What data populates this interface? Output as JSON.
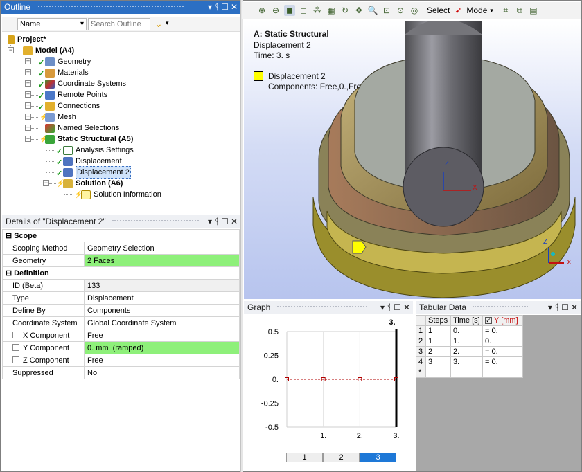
{
  "outline": {
    "title": "Outline",
    "filter_name": "Name",
    "search_placeholder": "Search Outline",
    "nodes": [
      {
        "label": "Project*"
      },
      {
        "label": "Model (A4)"
      },
      {
        "label": "Geometry"
      },
      {
        "label": "Materials"
      },
      {
        "label": "Coordinate Systems"
      },
      {
        "label": "Remote Points"
      },
      {
        "label": "Connections"
      },
      {
        "label": "Mesh"
      },
      {
        "label": "Named Selections"
      },
      {
        "label": "Static Structural (A5)"
      },
      {
        "label": "Analysis Settings"
      },
      {
        "label": "Displacement"
      },
      {
        "label": "Displacement 2"
      },
      {
        "label": "Solution (A6)"
      },
      {
        "label": "Solution Information"
      }
    ]
  },
  "details": {
    "title": "Details of \"Displacement 2\"",
    "groups": {
      "scope": "Scope",
      "definition": "Definition"
    },
    "rows": [
      {
        "label": "Scoping Method",
        "value": "Geometry Selection"
      },
      {
        "label": "Geometry",
        "value": "2 Faces"
      },
      {
        "label": "ID (Beta)",
        "value": "133"
      },
      {
        "label": "Type",
        "value": "Displacement"
      },
      {
        "label": "Define By",
        "value": "Components"
      },
      {
        "label": "Coordinate System",
        "value": "Global Coordinate System"
      },
      {
        "label": "X Component",
        "value": "Free"
      },
      {
        "label": "Y Component",
        "value": "0. mm  (ramped)"
      },
      {
        "label": "Z Component",
        "value": "Free"
      },
      {
        "label": "Suppressed",
        "value": "No"
      }
    ]
  },
  "toolbar": {
    "select_label": "Select",
    "mode_label": "Mode"
  },
  "viewport": {
    "title": "A: Static Structural",
    "subtitle": "Displacement 2",
    "time": "Time: 3. s",
    "legend_label": "Displacement 2",
    "legend_components": "Components: Free,0.,Free mm",
    "axis_z": "Z",
    "axis_x": "X",
    "legend_color": "#ffff00"
  },
  "graph": {
    "title": "Graph",
    "tabs": [
      "1",
      "2",
      "3"
    ],
    "selected_tab": "3"
  },
  "tabular": {
    "title": "Tabular Data",
    "headers": [
      "Steps",
      "Time [s]",
      "Y [mm]"
    ],
    "rows": [
      {
        "n": "1",
        "steps": "1",
        "time": "0.",
        "y": "= 0."
      },
      {
        "n": "2",
        "steps": "1",
        "time": "1.",
        "y": "0."
      },
      {
        "n": "3",
        "steps": "2",
        "time": "2.",
        "y": "= 0."
      },
      {
        "n": "4",
        "steps": "3",
        "time": "3.",
        "y": "= 0."
      },
      {
        "n": "*",
        "steps": "",
        "time": "",
        "y": ""
      }
    ]
  },
  "chart_data": {
    "type": "line",
    "x": [
      0,
      1,
      2,
      3
    ],
    "series": [
      {
        "values": [
          0,
          0,
          0,
          0
        ]
      }
    ],
    "xticks": [
      "1.",
      "2.",
      "3."
    ],
    "yticks": [
      "0.5",
      "0.25",
      "0.",
      "-0.25",
      "-0.5"
    ],
    "top_label": "3.",
    "xlim": [
      0,
      3
    ],
    "ylim": [
      -0.5,
      0.5
    ],
    "current_time": 3,
    "grid": true,
    "line_color": "#b00000"
  }
}
